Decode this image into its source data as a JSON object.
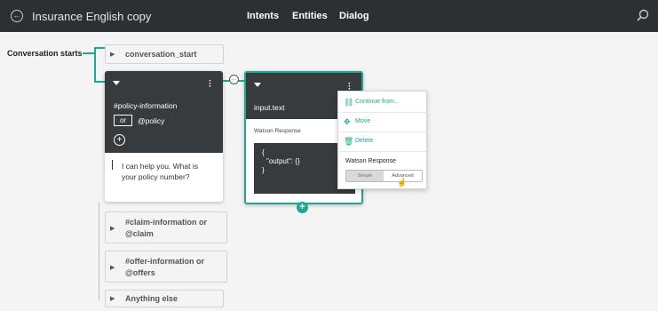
{
  "header": {
    "title": "Insurance English copy",
    "tabs": [
      "Intents",
      "Entities",
      "Dialog"
    ]
  },
  "tree": {
    "conversation_starts": "Conversation starts",
    "start_node": "conversation_start",
    "nodes": [
      {
        "line1": "#claim-information  or",
        "line2": "@claim"
      },
      {
        "line1": "#offer-information  or",
        "line2": "@offers"
      },
      {
        "line1": "Anything else"
      }
    ]
  },
  "policy_card": {
    "intent": "#policy-information",
    "operator": "or",
    "entity": "@policy",
    "response": "I can help you. What is your policy number?"
  },
  "input_card": {
    "title": "input.text",
    "response_label": "Watson Response",
    "code_brace_open": "{",
    "code_output": "\"output\": {}",
    "code_brace_close": "}"
  },
  "menu": {
    "items": [
      "Continue from...",
      "Move",
      "Delete"
    ],
    "section_label": "Watson Response",
    "toggle": [
      "Simple",
      "Advanced"
    ],
    "toggle_selected": "Advanced"
  },
  "colors": {
    "accent": "#20a692",
    "header": "#2d3032",
    "card_head": "#373b3d"
  }
}
